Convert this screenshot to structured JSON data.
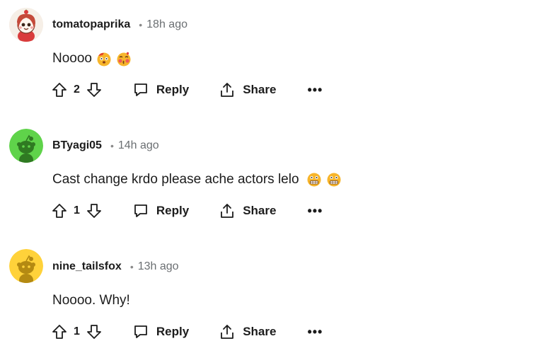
{
  "comments": [
    {
      "author": "tomatopaprika",
      "time": "18h ago",
      "body": "Noooo",
      "emojis": [
        "shocked-face-emoji",
        "blushing-kiss-face-emoji"
      ],
      "score": "2",
      "reply_label": "Reply",
      "share_label": "Share",
      "more_label": "•••",
      "avatar": "snoo-avatar-tomato-girl"
    },
    {
      "author": "BTyagi05",
      "time": "14h ago",
      "body": "Cast change krdo please ache actors lelo",
      "emojis": [
        "grimacing-face-emoji",
        "grimacing-face-emoji"
      ],
      "score": "1",
      "reply_label": "Reply",
      "share_label": "Share",
      "more_label": "•••",
      "avatar": "snoo-avatar-green",
      "avatar_color": "#5fd34a"
    },
    {
      "author": "nine_tailsfox",
      "time": "13h ago",
      "body": "Noooo. Why!",
      "emojis": [],
      "score": "1",
      "reply_label": "Reply",
      "share_label": "Share",
      "more_label": "•••",
      "avatar": "snoo-avatar-yellow",
      "avatar_color": "#ffd23a"
    }
  ],
  "meta_separator": "•"
}
